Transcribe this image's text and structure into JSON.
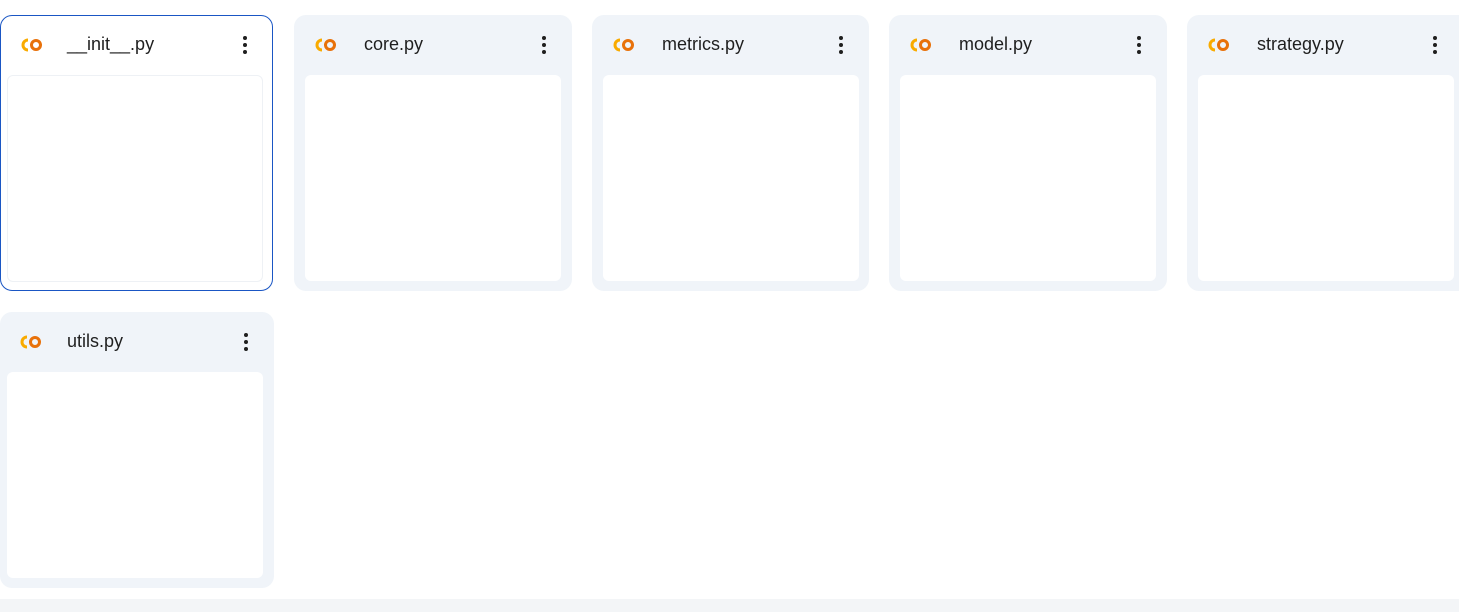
{
  "colors": {
    "card_bg": "#f0f4f9",
    "preview_bg": "#ffffff",
    "selected_border": "#1a56c4",
    "colab_orange": "#f9ab00",
    "colab_dark_orange": "#e8710a",
    "text": "#1f1f1f"
  },
  "files": [
    {
      "name": "__init__.py",
      "icon": "colab-icon",
      "selected": true
    },
    {
      "name": "core.py",
      "icon": "colab-icon",
      "selected": false
    },
    {
      "name": "metrics.py",
      "icon": "colab-icon",
      "selected": false
    },
    {
      "name": "model.py",
      "icon": "colab-icon",
      "selected": false
    },
    {
      "name": "strategy.py",
      "icon": "colab-icon",
      "selected": false
    },
    {
      "name": "utils.py",
      "icon": "colab-icon",
      "selected": false
    }
  ]
}
